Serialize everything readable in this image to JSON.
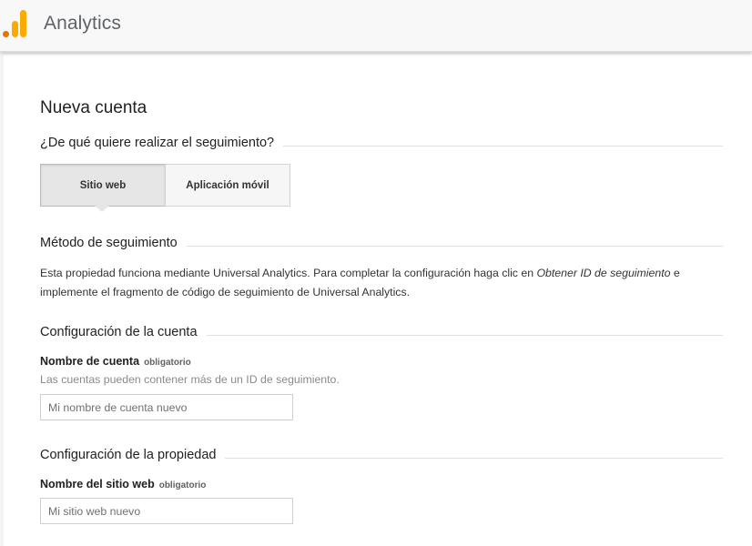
{
  "header": {
    "app_title": "Analytics",
    "logo_icon": "analytics-bars-logo",
    "logo_colors": [
      "#f9ab00",
      "#e37400"
    ]
  },
  "page": {
    "title": "Nueva cuenta"
  },
  "tracking_target": {
    "heading": "¿De qué quiere realizar el seguimiento?",
    "options": [
      {
        "label": "Sitio web",
        "selected": true
      },
      {
        "label": "Aplicación móvil",
        "selected": false
      }
    ]
  },
  "tracking_method": {
    "heading": "Método de seguimiento",
    "text_before": "Esta propiedad funciona mediante Universal Analytics. Para completar la configuración haga clic en ",
    "text_emphasis": "Obtener ID de seguimiento",
    "text_after": " e implemente el fragmento de código de seguimiento de Universal Analytics."
  },
  "account_config": {
    "heading": "Configuración de la cuenta",
    "field_label": "Nombre de cuenta",
    "required_label": "obligatorio",
    "helper": "Las cuentas pueden contener más de un ID de seguimiento.",
    "input_value": "",
    "input_placeholder": "Mi nombre de cuenta nuevo"
  },
  "property_config": {
    "heading": "Configuración de la propiedad",
    "field_label": "Nombre del sitio web",
    "required_label": "obligatorio",
    "input_value": "",
    "input_placeholder": "Mi sitio web nuevo"
  }
}
